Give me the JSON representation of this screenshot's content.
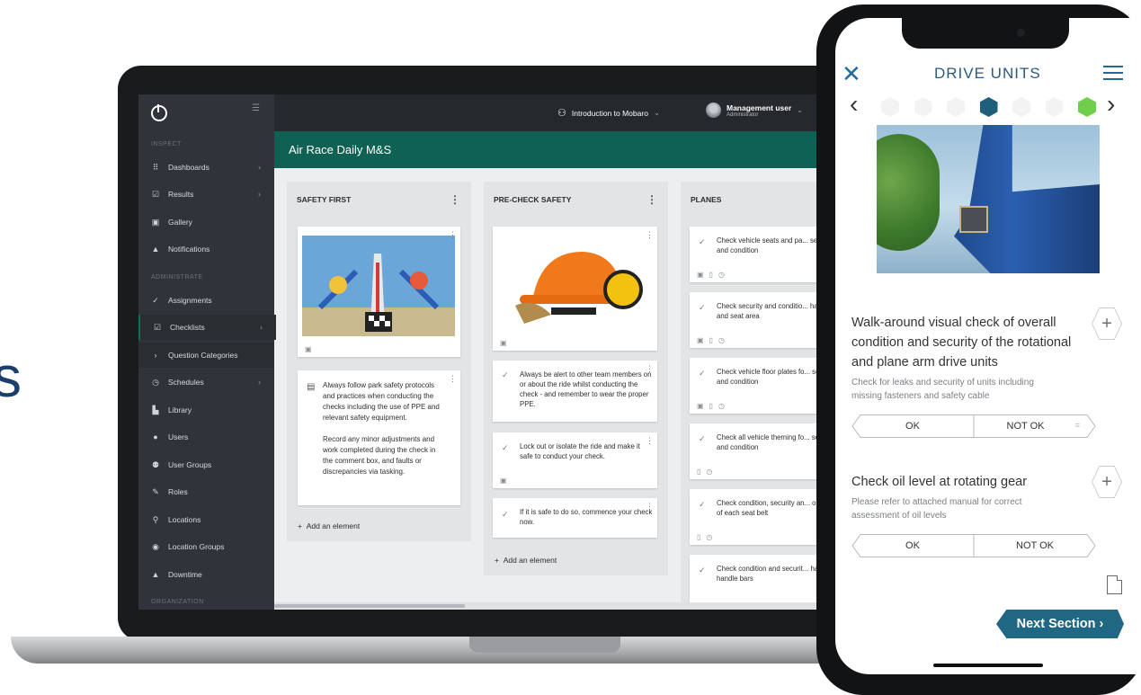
{
  "edge_text": "s",
  "web": {
    "sidebar": {
      "sections": [
        {
          "label": "INSPECT"
        },
        {
          "label": "ADMINISTRATE"
        },
        {
          "label": "ORGANIZATION"
        }
      ],
      "items": [
        {
          "label": "Dashboards",
          "icon": "grid-icon",
          "glyph": "⠿"
        },
        {
          "label": "Results",
          "icon": "checkbox-icon",
          "glyph": "☑"
        },
        {
          "label": "Gallery",
          "icon": "gallery-icon",
          "glyph": "▣"
        },
        {
          "label": "Notifications",
          "icon": "bell-icon",
          "glyph": "🔔"
        },
        {
          "label": "Assignments",
          "icon": "check-icon",
          "glyph": "✓"
        },
        {
          "label": "Checklists",
          "icon": "checklist-icon",
          "glyph": "☑"
        },
        {
          "label": "Question Categories",
          "icon": "bullet-icon",
          "glyph": "•"
        },
        {
          "label": "Schedules",
          "icon": "clock-icon",
          "glyph": "◷"
        },
        {
          "label": "Library",
          "icon": "file-icon",
          "glyph": "▙"
        },
        {
          "label": "Users",
          "icon": "user-icon",
          "glyph": "●"
        },
        {
          "label": "User Groups",
          "icon": "users-icon",
          "glyph": "⚉"
        },
        {
          "label": "Roles",
          "icon": "wrench-icon",
          "glyph": "✎"
        },
        {
          "label": "Locations",
          "icon": "pin-icon",
          "glyph": "⚲"
        },
        {
          "label": "Location Groups",
          "icon": "pin-group-icon",
          "glyph": "◉"
        },
        {
          "label": "Downtime",
          "icon": "warning-icon",
          "glyph": "▲"
        }
      ]
    },
    "topbar": {
      "org_label": "Introduction to Mobaro",
      "user_name": "Management user",
      "user_role": "Administrator"
    },
    "page_title": "Air Race Daily M&S",
    "columns": [
      {
        "title": "SAFETY FIRST"
      },
      {
        "title": "PRE-CHECK SAFETY"
      },
      {
        "title": "PLANES"
      }
    ],
    "safety_first": {
      "note_lines": [
        "Always follow park safety protocols",
        "and practices when conducting the",
        "checks including the use of PPE and",
        "relevant safety equipment.",
        "",
        "Record any minor adjustments and",
        "work completed during the check in",
        "the comment box, and faults or",
        "discrepancies via tasking."
      ],
      "add_label": "Add an element"
    },
    "pre_check": {
      "items": [
        "Always be alert to other team members on or about the ride whilst conducting the check - and remember to wear the proper PPE.",
        "Lock out or isolate the ride and make it safe to conduct your check.",
        "If it is safe to do so, commence your check now."
      ],
      "add_label": "Add an element"
    },
    "planes": {
      "items": [
        "Check vehicle seats and pa... security and condition",
        "Check security and conditio... harness and seat area",
        "Check vehicle floor plates fo... security and condition",
        "Check all vehicle theming fo... security and condition",
        "Check condition, security an... operation of each seat belt",
        "Check condition and securit... harness handle bars"
      ]
    }
  },
  "mobile": {
    "title": "DRIVE UNITS",
    "progress": {
      "steps": 7,
      "current_index": 3,
      "completed_index": 6,
      "colors": {
        "current": "#1e5f7c",
        "done": "#6fcf4a",
        "todo": "#f3f3f4"
      }
    },
    "questions": [
      {
        "title_lines": [
          "Walk-around visual check of overall",
          "condition and security of the rotational",
          "and plane arm drive units"
        ],
        "desc_lines": [
          "Check for leaks and security of units including",
          "missing fasteners and safety cable"
        ],
        "ok": "OK",
        "not_ok": "NOT OK"
      },
      {
        "title_lines": [
          "Check oil level at rotating gear"
        ],
        "desc_lines": [
          "Please refer to attached manual for correct",
          "assessment of oil levels"
        ],
        "ok": "OK",
        "not_ok": "NOT OK"
      }
    ],
    "next_label": "Next Section"
  }
}
